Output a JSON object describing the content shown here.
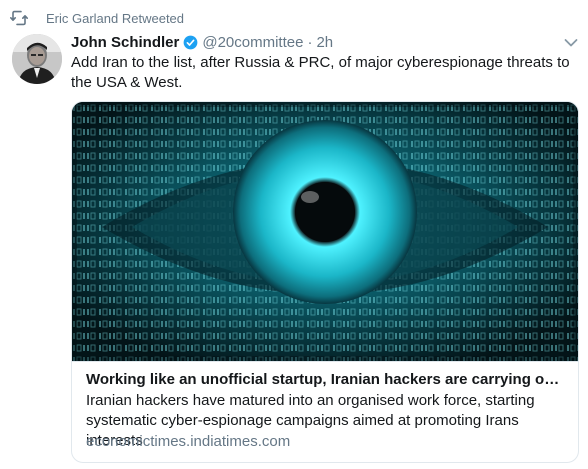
{
  "retweet": {
    "icon": "retweet-icon",
    "text": "Eric Garland Retweeted"
  },
  "tweet": {
    "author_name": "John Schindler",
    "verified": true,
    "handle": "@20committee",
    "separator": "·",
    "time": "2h",
    "text": "Add Iran to the list, after Russia & PRC, of major cyberespionage threats to the USA & West.",
    "menu_icon": "chevron-down-icon"
  },
  "card": {
    "image_icon": "binary-eye-image",
    "title": "Working like an unofficial startup, Iranian hackers are carrying out cy…",
    "description": "Iranian hackers have matured into an organised work force, starting systematic cyber-espionage campaigns aimed at promoting Irans interests",
    "domain": "economictimes.indiatimes.com"
  },
  "colors": {
    "text": "#14171a",
    "secondary": "#657786",
    "verified_blue": "#1da1f2",
    "border": "#e1e8ed"
  }
}
